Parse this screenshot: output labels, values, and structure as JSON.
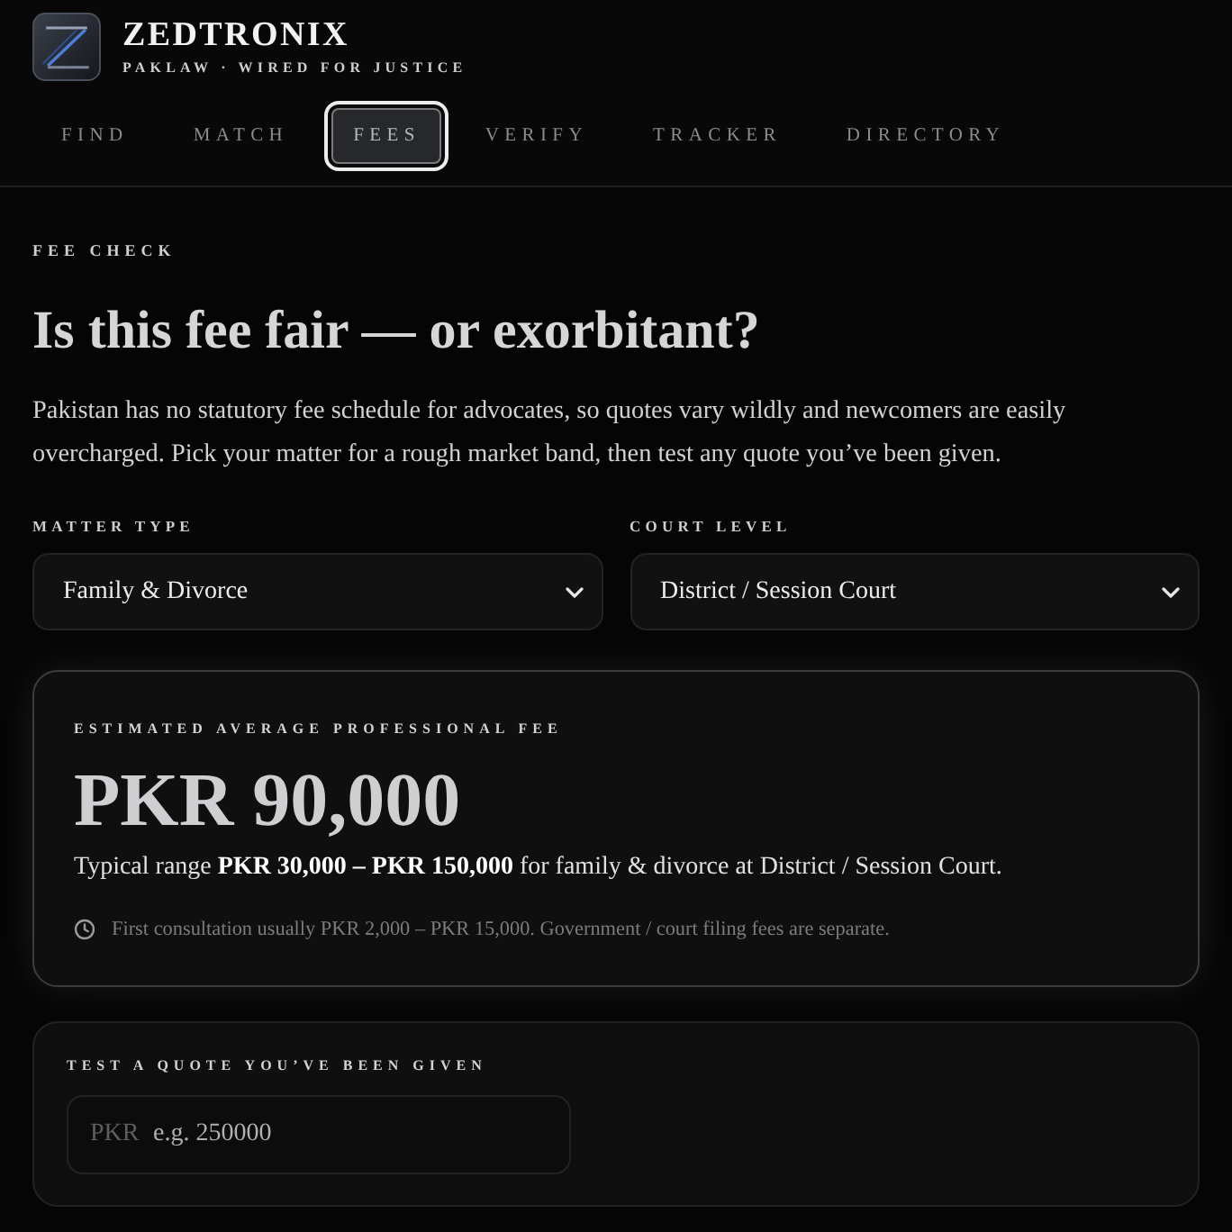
{
  "brand": {
    "name": "ZEDTRONIX",
    "tagline": "PAKLAW · WIRED FOR JUSTICE"
  },
  "tabs": [
    {
      "label": "FIND",
      "selected": false
    },
    {
      "label": "MATCH",
      "selected": false
    },
    {
      "label": "FEES",
      "selected": true
    },
    {
      "label": "VERIFY",
      "selected": false
    },
    {
      "label": "TRACKER",
      "selected": false
    },
    {
      "label": "DIRECTORY",
      "selected": false
    }
  ],
  "section": {
    "eyebrow": "FEE CHECK",
    "title": "Is this fee fair — or exorbitant?",
    "intro": "Pakistan has no statutory fee schedule for advocates, so quotes vary wildly and newcomers are easily overcharged. Pick your matter for a rough market band, then test any quote you’ve been given."
  },
  "filters": [
    {
      "label": "MATTER TYPE",
      "value": "Family & Divorce"
    },
    {
      "label": "COURT LEVEL",
      "value": "District / Session Court"
    }
  ],
  "estimate": {
    "label": "ESTIMATED AVERAGE PROFESSIONAL FEE",
    "amount": "PKR 90,000",
    "range": "Typical range **PKR 30,000 – PKR 150,000** for family & divorce at District / Session Court.",
    "note": "First consultation usually PKR 2,000 – PKR 15,000. Government / court filing fees are separate."
  },
  "quote_test": {
    "label": "TEST A QUOTE YOU’VE BEEN GIVEN",
    "prefix": "PKR",
    "placeholder": "e.g. 250000"
  }
}
